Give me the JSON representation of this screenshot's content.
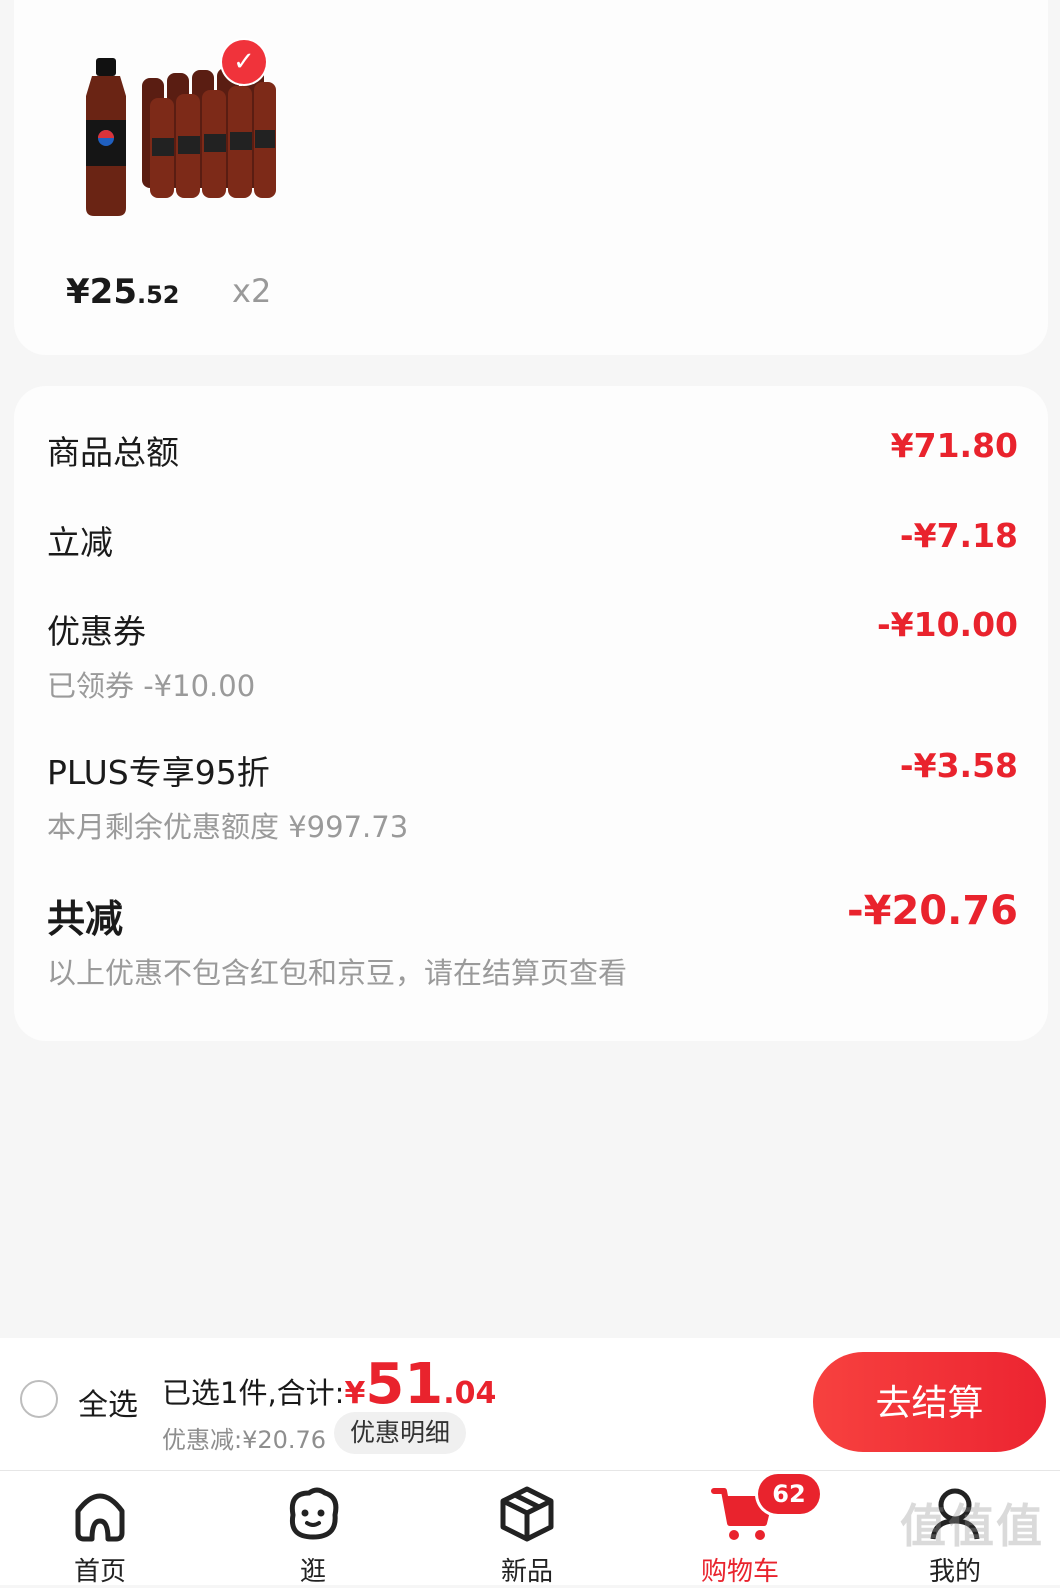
{
  "product": {
    "price_int": "¥25",
    "price_dec": ".52",
    "quantity": "x2",
    "selected": true
  },
  "discounts": {
    "goods_total_label": "商品总额",
    "goods_total_amount": "¥71.80",
    "instant_label": "立减",
    "instant_amount": "-¥7.18",
    "coupon_label": "优惠券",
    "coupon_amount": "-¥10.00",
    "coupon_sub": "已领券 -¥10.00",
    "plus_label": "PLUS专享95折",
    "plus_amount": "-¥3.58",
    "plus_sub": "本月剩余优惠额度 ¥997.73",
    "total_label": "共减",
    "total_amount": "-¥20.76",
    "note": "以上优惠不包含红包和京豆，请在结算页查看"
  },
  "checkout": {
    "select_all": "全选",
    "selected_text": "已选1件,合计:",
    "currency": "¥",
    "total_int": "51",
    "total_dec": ".04",
    "saved_text": "优惠减:¥20.76",
    "detail_button": "优惠明细",
    "checkout_button": "去结算"
  },
  "tabs": [
    {
      "label": "首页",
      "icon": "home-icon"
    },
    {
      "label": "逛",
      "icon": "face-icon"
    },
    {
      "label": "新品",
      "icon": "cube-icon"
    },
    {
      "label": "购物车",
      "icon": "cart-icon",
      "active": true
    },
    {
      "label": "我的",
      "icon": "user-icon"
    }
  ],
  "cart_badge": "62",
  "colors": {
    "accent": "#e9232d"
  },
  "watermark": "值什么值得买"
}
